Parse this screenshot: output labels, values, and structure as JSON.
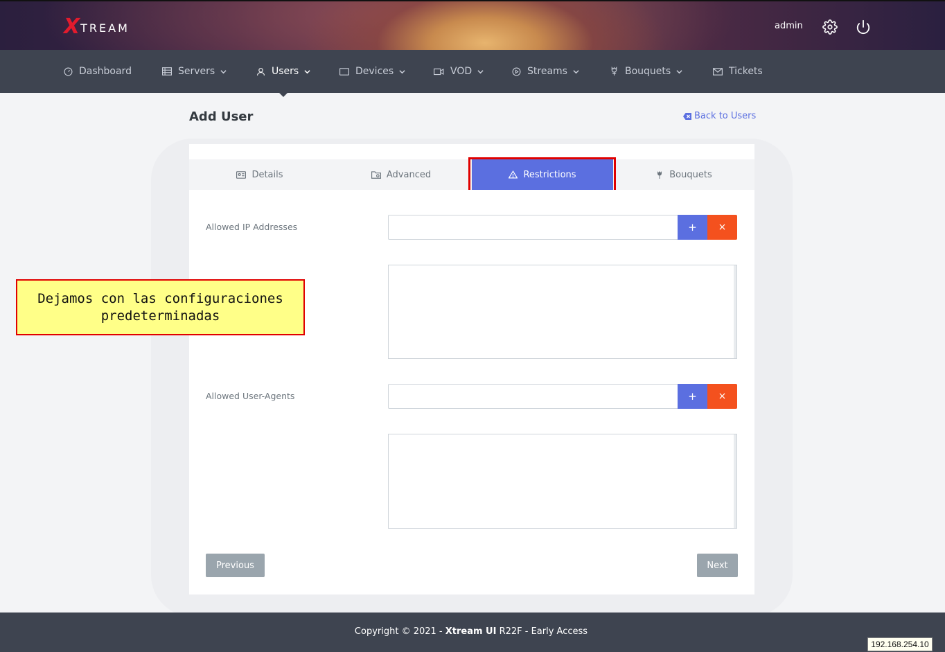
{
  "header": {
    "logo_mark": "X",
    "logo_text": "TREAM",
    "user": "admin",
    "icons": [
      "gear-icon",
      "power-icon"
    ]
  },
  "nav": {
    "items": [
      {
        "label": "Dashboard",
        "icon": "dashboard-icon",
        "dropdown": false
      },
      {
        "label": "Servers",
        "icon": "servers-icon",
        "dropdown": true
      },
      {
        "label": "Users",
        "icon": "user-icon",
        "dropdown": true,
        "active": true
      },
      {
        "label": "Devices",
        "icon": "devices-icon",
        "dropdown": true
      },
      {
        "label": "VOD",
        "icon": "video-icon",
        "dropdown": true
      },
      {
        "label": "Streams",
        "icon": "play-icon",
        "dropdown": true
      },
      {
        "label": "Bouquets",
        "icon": "flower-icon",
        "dropdown": true
      },
      {
        "label": "Tickets",
        "icon": "mail-icon",
        "dropdown": false
      }
    ]
  },
  "page": {
    "title": "Add User",
    "back_label": "Back to Users"
  },
  "tabs": [
    {
      "label": "Details",
      "icon": "id-card-icon"
    },
    {
      "label": "Advanced",
      "icon": "folder-gear-icon"
    },
    {
      "label": "Restrictions",
      "icon": "warning-triangle-icon",
      "active": true
    },
    {
      "label": "Bouquets",
      "icon": "flower-icon"
    }
  ],
  "form": {
    "ip_label": "Allowed IP Addresses",
    "ip_value": "",
    "ua_label": "Allowed User-Agents",
    "ua_value": "",
    "add_label": "+",
    "remove_label": "×"
  },
  "buttons": {
    "previous": "Previous",
    "next": "Next"
  },
  "callout": {
    "text": "Dejamos con las configuraciones\npredeterminadas"
  },
  "footer": {
    "prefix": "Copyright © 2021 - ",
    "brand": "Xtream UI",
    "suffix": " R22F - Early Access"
  },
  "ip_tag": "192.168.254.10",
  "colors": {
    "primary": "#5b6fe0",
    "danger": "#f4511e",
    "nav_bg": "#3e4450",
    "logo_red": "#e21b2d",
    "highlight_red": "#e00000",
    "callout_bg": "#ffff88"
  }
}
